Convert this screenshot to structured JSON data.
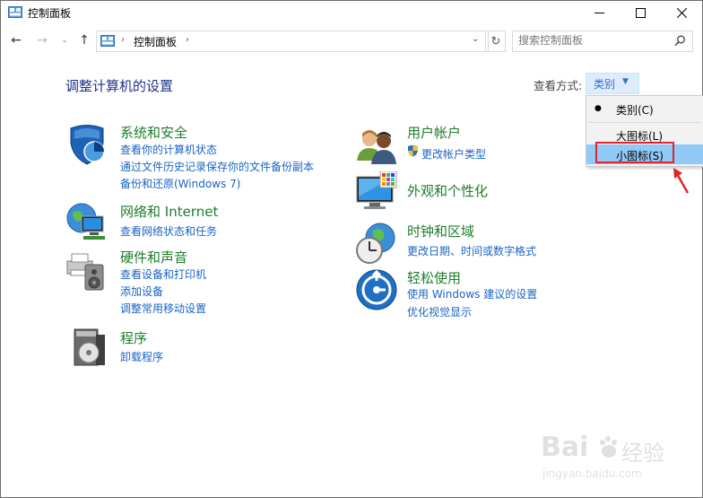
{
  "window": {
    "title": "控制面板"
  },
  "nav": {
    "back": "←",
    "forward": "→",
    "recent": "⌄",
    "up": "↑",
    "address": "控制面板",
    "refresh": "↻",
    "search_placeholder": "搜索控制面板"
  },
  "main": {
    "title": "调整计算机的设置",
    "view_by_label": "查看方式:",
    "view_by_value": "类别"
  },
  "dropdown": {
    "items": [
      {
        "label": "类别(C)",
        "selected": true
      },
      {
        "label": "大图标(L)",
        "selected": false
      },
      {
        "label": "小图标(S)",
        "selected": false,
        "highlighted": true
      }
    ]
  },
  "categories": {
    "security": {
      "title": "系统和安全",
      "links": [
        "查看你的计算机状态",
        "通过文件历史记录保存你的文件备份副本",
        "备份和还原(Windows 7)"
      ]
    },
    "network": {
      "title": "网络和 Internet",
      "links": [
        "查看网络状态和任务"
      ]
    },
    "hardware": {
      "title": "硬件和声音",
      "links": [
        "查看设备和打印机",
        "添加设备",
        "调整常用移动设置"
      ]
    },
    "programs": {
      "title": "程序",
      "links": [
        "卸载程序"
      ]
    },
    "users": {
      "title": "用户帐户",
      "links": [
        "更改帐户类型"
      ]
    },
    "appearance": {
      "title": "外观和个性化",
      "links": []
    },
    "clock": {
      "title": "时钟和区域",
      "links": [
        "更改日期、时间或数字格式"
      ]
    },
    "ease": {
      "title": "轻松使用",
      "links": [
        "使用 Windows 建议的设置",
        "优化视觉显示"
      ]
    }
  },
  "watermark": {
    "logo": "Bai",
    "brand": "经验",
    "url": "jingyan.baidu.com"
  },
  "colors": {
    "title_blue": "#1e3287",
    "category_green": "#1e7d2c",
    "link_blue": "#1a64c4",
    "highlight": "#91c9f7",
    "annotation_red": "#e0242b"
  }
}
